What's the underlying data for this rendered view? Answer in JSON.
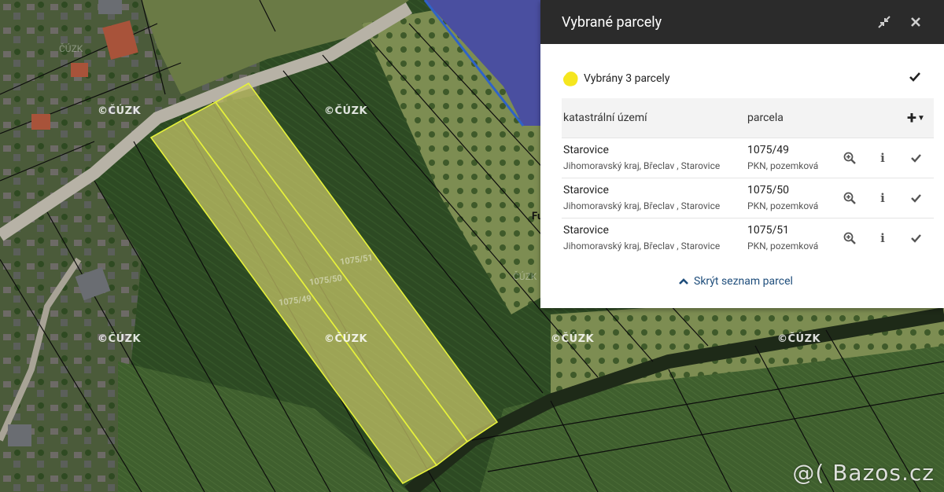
{
  "map": {
    "watermark": "©ČÚZK",
    "cuzk_text": "ČÚZK",
    "parcel_labels": [
      "1075/49",
      "1075/50",
      "1075/51"
    ],
    "map_text": "Fu",
    "bazos": "@( Bazos.cz"
  },
  "panel": {
    "title": "Vybrané parcely",
    "collapse_icon": "collapse-arrows-icon",
    "close_icon": "close-icon",
    "summary": {
      "text": "Vybrány 3 parcely",
      "color": "#f5e61f"
    },
    "table": {
      "headers": {
        "ku": "katastrální území",
        "parcela": "parcela",
        "add": "+"
      },
      "rows": [
        {
          "ku_name": "Starovice",
          "ku_region": "Jihomoravský kraj, Břeclav , Starovice",
          "parcela": "1075/49",
          "type": "PKN, pozemková"
        },
        {
          "ku_name": "Starovice",
          "ku_region": "Jihomoravský kraj, Břeclav , Starovice",
          "parcela": "1075/50",
          "type": "PKN, pozemková"
        },
        {
          "ku_name": "Starovice",
          "ku_region": "Jihomoravský kraj, Břeclav , Starovice",
          "parcela": "1075/51",
          "type": "PKN, pozemková"
        }
      ]
    },
    "hide_list": "Skrýt seznam parcel"
  },
  "colors": {
    "panel_header": "#2b2b2b",
    "parcel_fill": "#c9c86a",
    "parcel_stroke": "#e6f23a",
    "link": "#1e4d7b",
    "water": "#4a4fa0"
  }
}
